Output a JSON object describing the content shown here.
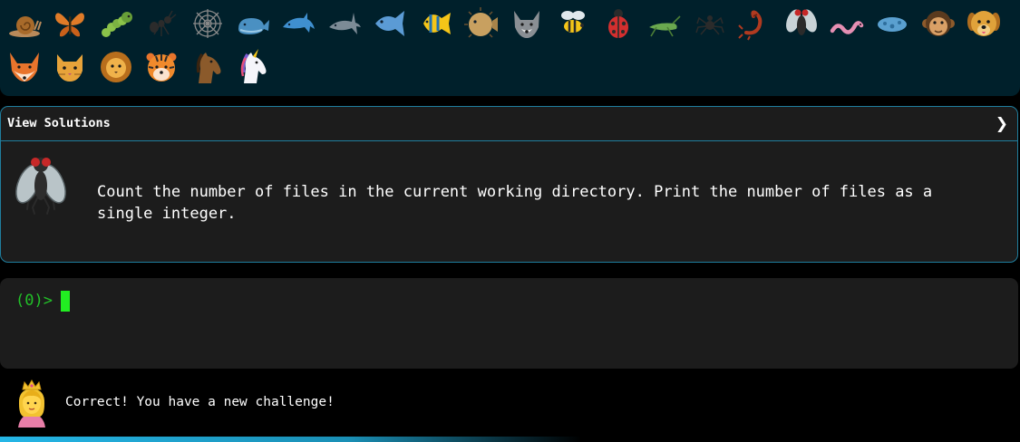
{
  "animals": [
    {
      "name": "snail"
    },
    {
      "name": "butterfly"
    },
    {
      "name": "caterpillar"
    },
    {
      "name": "ant"
    },
    {
      "name": "spider-web"
    },
    {
      "name": "whale"
    },
    {
      "name": "dolphin"
    },
    {
      "name": "shark"
    },
    {
      "name": "fish"
    },
    {
      "name": "tropical-fish"
    },
    {
      "name": "blowfish"
    },
    {
      "name": "wolf"
    },
    {
      "name": "bee"
    },
    {
      "name": "ladybug"
    },
    {
      "name": "cricket"
    },
    {
      "name": "spider"
    },
    {
      "name": "scorpion"
    },
    {
      "name": "fly"
    },
    {
      "name": "worm"
    },
    {
      "name": "microbe"
    },
    {
      "name": "monkey"
    },
    {
      "name": "dog"
    },
    {
      "name": "fox"
    },
    {
      "name": "cat"
    },
    {
      "name": "lion"
    },
    {
      "name": "tiger"
    },
    {
      "name": "horse"
    },
    {
      "name": "unicorn"
    }
  ],
  "panel": {
    "title": "View Solutions",
    "chevron": "❯",
    "avatar_icon": "fly",
    "challenge_text": "Count the number of files in the current working directory. Print the number of files as a\nsingle integer."
  },
  "terminal": {
    "prompt": "(0)>"
  },
  "status": {
    "avatar_icon": "princess",
    "message": "Correct! You have a new challenge!",
    "progress": 0.57
  },
  "colors": {
    "accent": "#1f7e9e",
    "prompt_green": "#22c028",
    "cursor_green": "#22ee22",
    "panel_bg": "#1c1c1c",
    "strip_bg": "#00202b"
  }
}
